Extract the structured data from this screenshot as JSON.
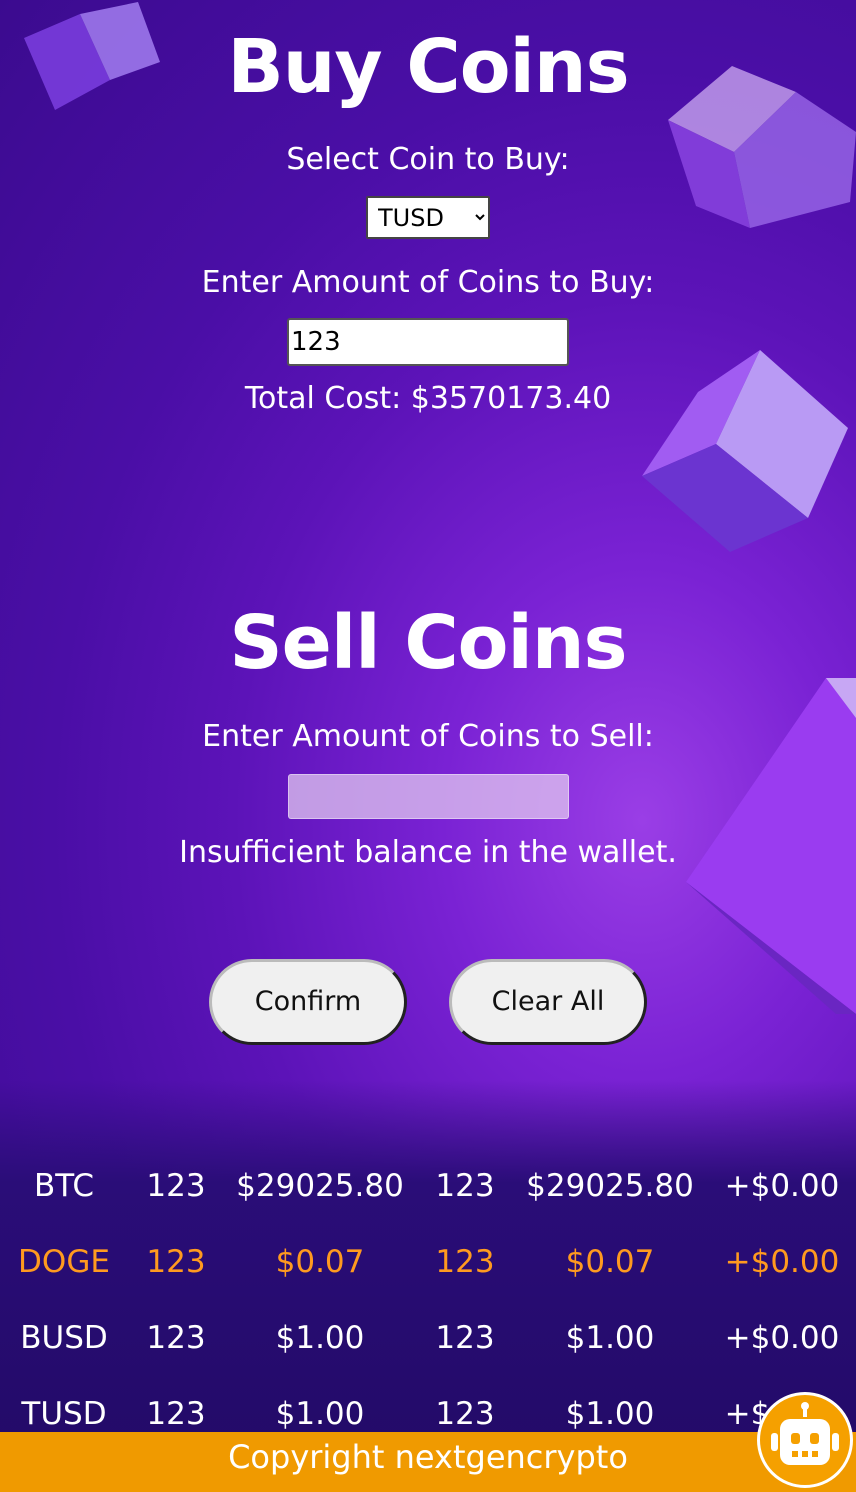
{
  "buy": {
    "title": "Buy Coins",
    "select_label": "Select Coin to Buy:",
    "selected_coin": "TUSD",
    "amount_label": "Enter Amount of Coins to Buy:",
    "amount_value": "123",
    "total_cost": "Total Cost: $3570173.40"
  },
  "sell": {
    "title": "Sell Coins",
    "amount_label": "Enter Amount of Coins to Sell:",
    "amount_value": "",
    "error": "Insufficient balance in the wallet."
  },
  "actions": {
    "confirm_label": "Confirm",
    "clear_label": "Clear All"
  },
  "table": {
    "rows": [
      {
        "coin": "BTC",
        "qty1": "123",
        "price1": "$29025.80",
        "qty2": "123",
        "price2": "$29025.80",
        "change": "+$0.00",
        "highlight": false
      },
      {
        "coin": "DOGE",
        "qty1": "123",
        "price1": "$0.07",
        "qty2": "123",
        "price2": "$0.07",
        "change": "+$0.00",
        "highlight": true
      },
      {
        "coin": "BUSD",
        "qty1": "123",
        "price1": "$1.00",
        "qty2": "123",
        "price2": "$1.00",
        "change": "+$0.00",
        "highlight": false
      },
      {
        "coin": "TUSD",
        "qty1": "123",
        "price1": "$1.00",
        "qty2": "123",
        "price2": "$1.00",
        "change": "+$0.00",
        "highlight": false
      }
    ]
  },
  "footer": {
    "text": "Copyright nextgencrypto"
  },
  "colors": {
    "highlight": "#ff9a1f",
    "footer": "#f09a00",
    "background": "#4a0ea6"
  },
  "icons": {
    "chatbot": "robot-icon"
  }
}
